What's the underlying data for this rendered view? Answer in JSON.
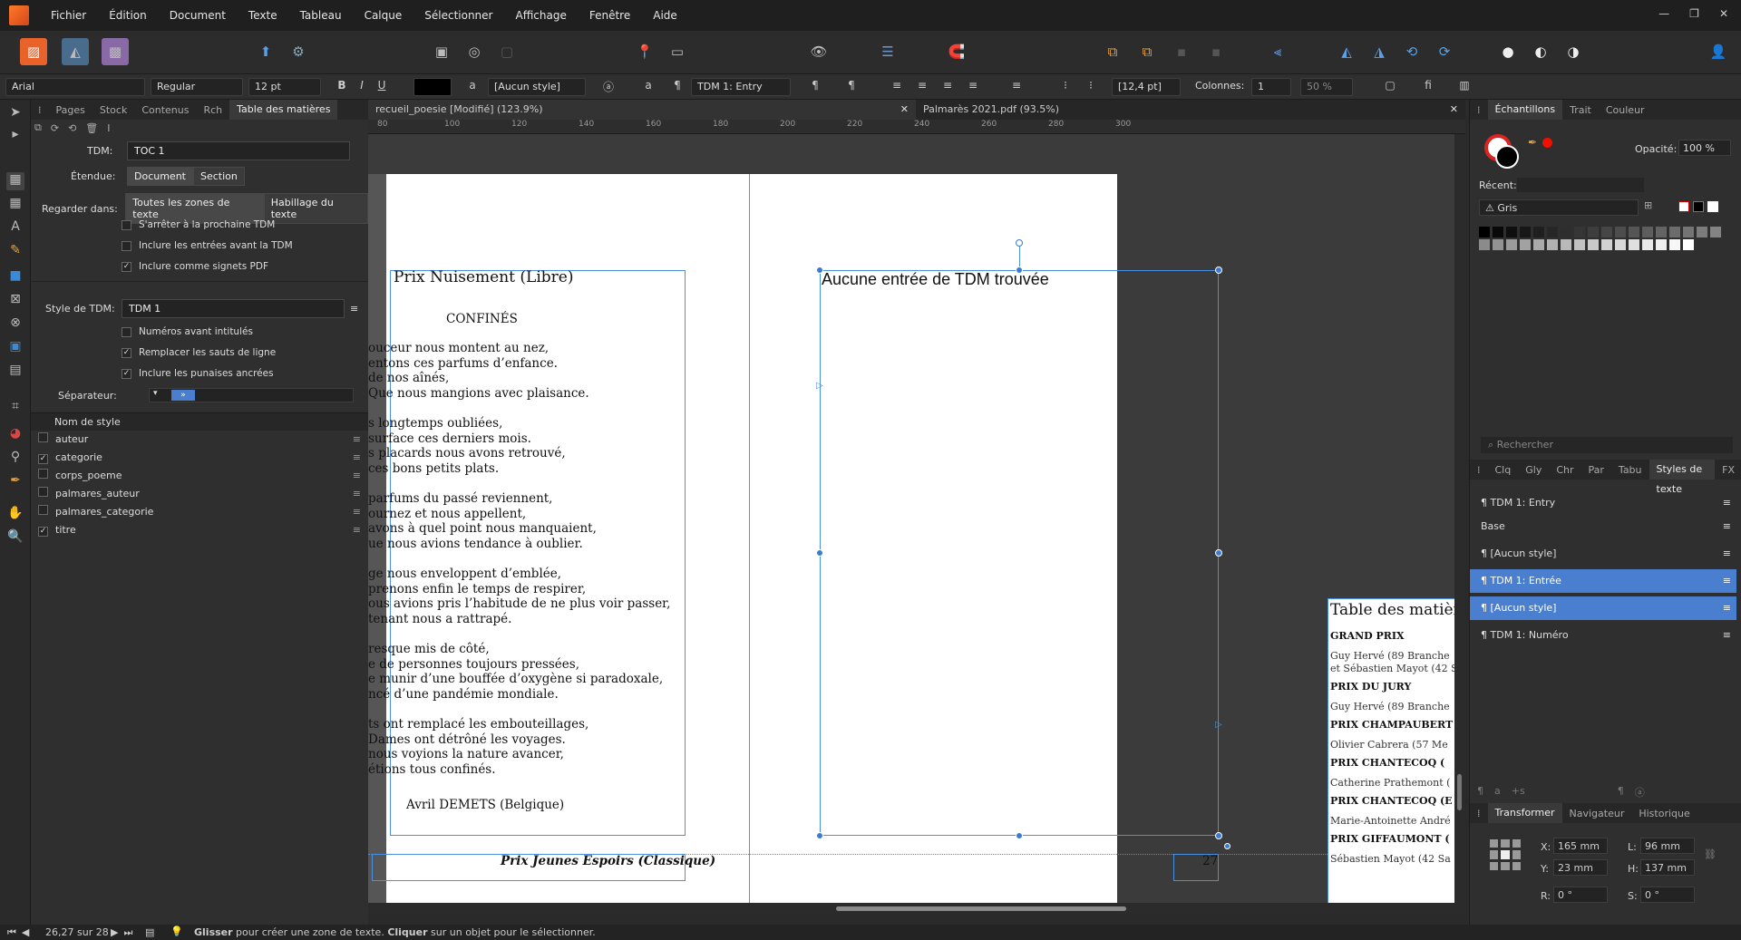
{
  "menu": [
    "Fichier",
    "Édition",
    "Document",
    "Texte",
    "Tableau",
    "Calque",
    "Sélectionner",
    "Affichage",
    "Fenêtre",
    "Aide"
  ],
  "context_toolbar": {
    "font": "Arial",
    "weight": "Regular",
    "size": "12 pt",
    "bold": "B",
    "italic": "I",
    "underline": "U",
    "char_style": "[Aucun style]",
    "para_style": "TDM 1: Entry",
    "leading": "[12,4 pt]",
    "columns_label": "Colonnes:",
    "columns_value": "1",
    "gutter": "50 %"
  },
  "left_panel": {
    "tabs": [
      "Pages",
      "Stock",
      "Contenus",
      "Rch",
      "Table des matières"
    ],
    "active_tab": "Table des matières",
    "tdm_label": "TDM:",
    "tdm_value": "TOC 1",
    "etendue_label": "Étendue:",
    "etendue_options": [
      "Document",
      "Section"
    ],
    "regarder_label": "Regarder dans:",
    "regarder_options": [
      "Toutes les zones de texte",
      "Habillage du texte"
    ],
    "opt_stop": "S'arrêter à la prochaine TDM",
    "opt_include": "Inclure les entrées avant la TDM",
    "opt_pdf": "Inclure comme signets PDF",
    "style_tdm_label": "Style de TDM:",
    "style_tdm_value": "TDM 1",
    "opt_num": "Numéros avant intitulés",
    "opt_replace": "Remplacer les sauts de ligne",
    "opt_pins": "Inclure les punaises ancrées",
    "separateur_label": "Séparateur:",
    "separateur_value": "»",
    "style_header": "Nom de style",
    "styles": [
      {
        "name": "auteur",
        "checked": false
      },
      {
        "name": "categorie",
        "checked": true
      },
      {
        "name": "corps_poeme",
        "checked": false
      },
      {
        "name": "palmares_auteur",
        "checked": false
      },
      {
        "name": "palmares_categorie",
        "checked": false
      },
      {
        "name": "titre",
        "checked": true
      }
    ]
  },
  "doc_tabs": [
    {
      "label": "recueil_poesie [Modifié] (123.9%)"
    },
    {
      "label": "Palmarès 2021.pdf (93.5%)"
    }
  ],
  "ruler_ticks": [
    "80",
    "100",
    "120",
    "140",
    "160",
    "180",
    "200",
    "220",
    "240",
    "260",
    "280",
    "300"
  ],
  "page_left": {
    "title": "Prix Nuisement (Libre)",
    "subtitle": "CONFINÉS",
    "stanzas": [
      [
        "ouceur nous montent au nez,",
        "entons ces parfums d’enfance.",
        "de nos aînés,",
        "Que nous mangions avec plaisance."
      ],
      [
        "s longtemps oubliées,",
        "surface ces derniers mois.",
        "s placards nous avons retrouvé,",
        "ces bons petits plats."
      ],
      [
        "parfums du passé reviennent,",
        "ournez et nous appellent,",
        "avons à quel point nous manquaient,",
        "ue nous avions tendance à oublier."
      ],
      [
        "ge nous enveloppent d’emblée,",
        "prenons enfin le temps de respirer,",
        "ous avions pris l’habitude de ne plus voir passer,",
        "tenant nous a rattrapé."
      ],
      [
        "resque mis de côté,",
        "e de personnes toujours pressées,",
        "e munir d’une bouffée d’oxygène si paradoxale,",
        "ncé d’une pandémie mondiale."
      ],
      [
        "ts ont remplacé les embouteillages,",
        "Dames ont détrôné les voyages.",
        "nous voyions la nature avancer,",
        "étions tous confinés."
      ]
    ],
    "author": "Avril DEMETS (Belgique)",
    "footer_left": "Prix Jeunes Espoirs (Classique)"
  },
  "page_right": {
    "toc_message": "Aucune entrée de TDM trouvée",
    "page_number": "27"
  },
  "pdf_page": {
    "title": "Table des matièr",
    "entries": [
      {
        "cat": "GRAND PRIX",
        "lines": [
          "Guy Hervé (89 Branche",
          "et Sébastien Mayot (42 S"
        ]
      },
      {
        "cat": "PRIX DU JURY",
        "lines": [
          "Guy Hervé (89 Branche"
        ]
      },
      {
        "cat": "PRIX CHAMPAUBERT",
        "lines": [
          "Olivier Cabrera (57 Me"
        ]
      },
      {
        "cat": "PRIX CHANTECOQ (",
        "lines": [
          "Catherine Prathemont ("
        ]
      },
      {
        "cat": "PRIX CHANTECOQ (E",
        "lines": [
          "Marie-Antoinette André"
        ]
      },
      {
        "cat": "PRIX GIFFAUMONT (",
        "lines": [
          "Sébastien Mayot (42 Sa"
        ]
      }
    ]
  },
  "right_panel": {
    "top_tabs": [
      "Échantillons",
      "Trait",
      "Couleur"
    ],
    "opacity_label": "Opacité:",
    "opacity_value": "100 %",
    "recent_label": "Récent:",
    "palette": "Gris",
    "search_placeholder": "Rechercher",
    "mid_tabs": [
      "Clq",
      "Gly",
      "Chr",
      "Par",
      "Tabu",
      "Styles de texte",
      "FX"
    ],
    "text_styles": [
      {
        "name": "TDM 1: Entry",
        "selected": false
      },
      {
        "name": "Base",
        "selected": false
      },
      {
        "name": "[Aucun style]",
        "selected": false
      },
      {
        "name": "TDM 1: Entrée",
        "selected": true
      },
      {
        "name": "[Aucun style]",
        "selected": true
      },
      {
        "name": "TDM 1: Numéro",
        "selected": false
      }
    ],
    "bottom_tabs": [
      "Transformer",
      "Navigateur",
      "Historique"
    ],
    "x_label": "X:",
    "x_value": "165 mm",
    "y_label": "Y:",
    "y_value": "23 mm",
    "w_label": "L:",
    "w_value": "96 mm",
    "h_label": "H:",
    "h_value": "137 mm",
    "r_label": "R:",
    "r_value": "0 °",
    "s_label": "S:",
    "s_value": "0 °"
  },
  "status": {
    "pages": "26,27 sur 28",
    "hint_b1": "Glisser",
    "hint_t1": " pour créer une zone de texte. ",
    "hint_b2": "Cliquer",
    "hint_t2": " sur un objet pour le sélectionner."
  },
  "colors": {
    "accent": "#4a90e2",
    "selection": "#4a7fcf",
    "brand": "#e8622a"
  }
}
